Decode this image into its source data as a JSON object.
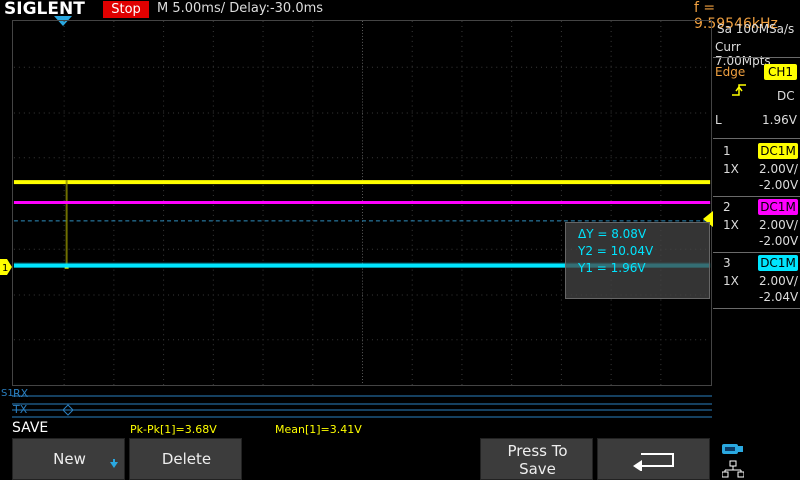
{
  "top": {
    "brand": "SIGLENT",
    "status": "Stop",
    "timebase": "M 5.00ms/ Delay:-30.0ms",
    "frequency": "f = 9.59546kHz"
  },
  "acquisition": {
    "sample_rate": "Sa 100MSa/s",
    "memory": "Curr 7.00Mpts"
  },
  "trigger": {
    "type": "Edge",
    "source": "CH1",
    "slope_icon": "rising-edge-icon",
    "coupling": "DC",
    "level_prefix": "L",
    "level": "1.96V"
  },
  "channels": [
    {
      "num": "1",
      "coupling": "DC1M",
      "probe": "1X",
      "scale": "2.00V/",
      "offset": "-2.00V",
      "color": "#ffff00"
    },
    {
      "num": "2",
      "coupling": "DC1M",
      "probe": "1X",
      "scale": "2.00V/",
      "offset": "-2.00V",
      "color": "#ff00ff"
    },
    {
      "num": "3",
      "coupling": "DC1M",
      "probe": "1X",
      "scale": "2.00V/",
      "offset": "-2.04V",
      "color": "#00e5ff"
    }
  ],
  "cursor_readout": {
    "delta_y": "ΔY = 8.08V",
    "y2": "Y2 = 10.04V",
    "y1": "Y1 = 1.96V"
  },
  "decode": {
    "label": "S1",
    "rx": "RX",
    "tx": "TX"
  },
  "menu_title": "SAVE",
  "measurements": {
    "pkpk": "Pk-Pk[1]=3.68V",
    "mean": "Mean[1]=3.41V"
  },
  "softkeys": {
    "new": "New",
    "delete": "Delete",
    "press_to_save_line1": "Press To",
    "press_to_save_line2": "Save"
  },
  "colors": {
    "ch1": "#ffff00",
    "ch2": "#ff00ff",
    "ch3": "#00e5ff",
    "stop": "#e00000",
    "frequency": "#f0a040",
    "decode": "#2a7fc0"
  }
}
